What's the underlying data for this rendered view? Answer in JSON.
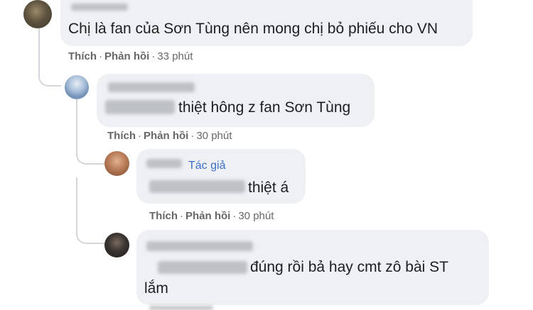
{
  "comments": [
    {
      "text": "Chị là fan của Sơn Tùng nên mong chị bỏ phiếu cho VN",
      "actions": {
        "like": "Thích",
        "reply": "Phản hồi",
        "time": "33 phút"
      }
    },
    {
      "text": "thiệt hông z fan Sơn Tùng",
      "actions": {
        "like": "Thích",
        "reply": "Phản hồi",
        "time": "30 phút"
      }
    },
    {
      "badge": "Tác giả",
      "text": "thiệt á",
      "actions": {
        "like": "Thích",
        "reply": "Phản hồi",
        "time": "30 phút"
      }
    },
    {
      "text": "đúng rồi bả hay cmt zô bài ST",
      "text_line2": "lắm"
    }
  ],
  "separator": "·",
  "colors": {
    "bubble": "#eef0f3",
    "action_text": "#65676b",
    "author_badge": "#3b6fc9"
  }
}
